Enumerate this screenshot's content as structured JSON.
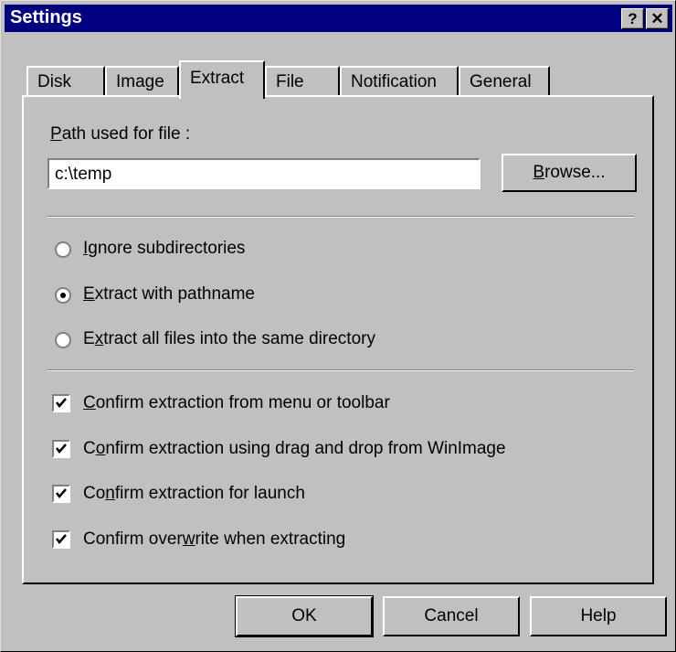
{
  "window": {
    "title": "Settings",
    "help_label": "?",
    "close_label": "✕"
  },
  "tabs": [
    {
      "label": "Disk"
    },
    {
      "label": "Image"
    },
    {
      "label": "Extract"
    },
    {
      "label": "File"
    },
    {
      "label": "Notification"
    },
    {
      "label": "General"
    }
  ],
  "path": {
    "label_accel": "P",
    "label_rest": "ath used for file :",
    "value": "c:\\temp",
    "browse_accel": "B",
    "browse_rest": "rowse..."
  },
  "radios": [
    {
      "pre": "",
      "accel": "I",
      "post": "gnore subdirectories",
      "checked": false
    },
    {
      "pre": "",
      "accel": "E",
      "post": "xtract with pathname",
      "checked": true
    },
    {
      "pre": "E",
      "accel": "x",
      "post": "tract all files into the same directory",
      "checked": false
    }
  ],
  "checkboxes": [
    {
      "pre": "",
      "accel": "C",
      "post": "onfirm extraction from menu or toolbar",
      "checked": true
    },
    {
      "pre": "C",
      "accel": "o",
      "post": "nfirm extraction using drag and drop from WinImage",
      "checked": true
    },
    {
      "pre": "Co",
      "accel": "n",
      "post": "firm extraction for launch",
      "checked": true
    },
    {
      "pre": "Confirm over",
      "accel": "w",
      "post": "rite when extracting",
      "checked": true
    }
  ],
  "buttons": {
    "ok": "OK",
    "cancel": "Cancel",
    "help": "Help"
  }
}
